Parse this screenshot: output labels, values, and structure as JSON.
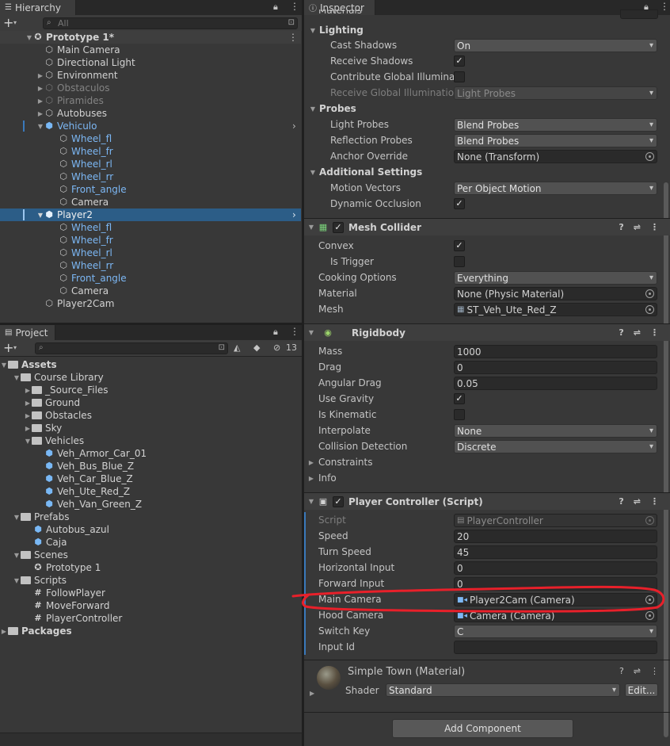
{
  "hierarchy": {
    "tab_label": "Hierarchy",
    "search_placeholder": "All",
    "scene_name": "Prototype 1*",
    "items": [
      {
        "label": "Main Camera"
      },
      {
        "label": "Directional Light"
      },
      {
        "label": "Environment"
      },
      {
        "label": "Obstaculos"
      },
      {
        "label": "Piramides"
      },
      {
        "label": "Autobuses"
      },
      {
        "label": "Vehiculo"
      },
      {
        "label": "Wheel_fl"
      },
      {
        "label": "Wheel_fr"
      },
      {
        "label": "Wheel_rl"
      },
      {
        "label": "Wheel_rr"
      },
      {
        "label": "Front_angle"
      },
      {
        "label": "Camera"
      },
      {
        "label": "Player2"
      },
      {
        "label": "Wheel_fl"
      },
      {
        "label": "Wheel_fr"
      },
      {
        "label": "Wheel_rl"
      },
      {
        "label": "Wheel_rr"
      },
      {
        "label": "Front_angle"
      },
      {
        "label": "Camera"
      },
      {
        "label": "Player2Cam"
      }
    ]
  },
  "project": {
    "tab_label": "Project",
    "hidden_count": "13",
    "tree": [
      {
        "label": "Assets"
      },
      {
        "label": "Course Library"
      },
      {
        "label": "_Source_Files"
      },
      {
        "label": "Ground"
      },
      {
        "label": "Obstacles"
      },
      {
        "label": "Sky"
      },
      {
        "label": "Vehicles"
      },
      {
        "label": "Veh_Armor_Car_01"
      },
      {
        "label": "Veh_Bus_Blue_Z"
      },
      {
        "label": "Veh_Car_Blue_Z"
      },
      {
        "label": "Veh_Ute_Red_Z"
      },
      {
        "label": "Veh_Van_Green_Z"
      },
      {
        "label": "Prefabs"
      },
      {
        "label": "Autobus_azul"
      },
      {
        "label": "Caja"
      },
      {
        "label": "Scenes"
      },
      {
        "label": "Prototype 1"
      },
      {
        "label": "Scripts"
      },
      {
        "label": "FollowPlayer"
      },
      {
        "label": "MoveForward"
      },
      {
        "label": "PlayerController"
      },
      {
        "label": "Packages"
      }
    ]
  },
  "inspector": {
    "tab_label": "Inspector",
    "top_cut_label": "Materials",
    "lighting": {
      "header": "Lighting",
      "cast_shadows_label": "Cast Shadows",
      "cast_shadows_value": "On",
      "receive_shadows_label": "Receive Shadows",
      "contribute_gi_label": "Contribute Global Illumination",
      "receive_gi_label": "Receive Global Illumination",
      "receive_gi_value": "Light Probes"
    },
    "probes": {
      "header": "Probes",
      "light_probes_label": "Light Probes",
      "light_probes_value": "Blend Probes",
      "reflection_probes_label": "Reflection Probes",
      "reflection_probes_value": "Blend Probes",
      "anchor_override_label": "Anchor Override",
      "anchor_override_value": "None (Transform)"
    },
    "additional": {
      "header": "Additional Settings",
      "motion_vectors_label": "Motion Vectors",
      "motion_vectors_value": "Per Object Motion",
      "dynamic_occlusion_label": "Dynamic Occlusion"
    },
    "mesh_collider": {
      "title": "Mesh Collider",
      "convex_label": "Convex",
      "is_trigger_label": "Is Trigger",
      "cooking_label": "Cooking Options",
      "cooking_value": "Everything",
      "material_label": "Material",
      "material_value": "None (Physic Material)",
      "mesh_label": "Mesh",
      "mesh_value": "ST_Veh_Ute_Red_Z"
    },
    "rigidbody": {
      "title": "Rigidbody",
      "mass_label": "Mass",
      "mass_value": "1000",
      "drag_label": "Drag",
      "drag_value": "0",
      "angular_drag_label": "Angular Drag",
      "angular_drag_value": "0.05",
      "use_gravity_label": "Use Gravity",
      "is_kinematic_label": "Is Kinematic",
      "interpolate_label": "Interpolate",
      "interpolate_value": "None",
      "collision_label": "Collision Detection",
      "collision_value": "Discrete",
      "constraints_label": "Constraints",
      "info_label": "Info"
    },
    "player_controller": {
      "title": "Player Controller (Script)",
      "script_label": "Script",
      "script_value": "PlayerController",
      "speed_label": "Speed",
      "speed_value": "20",
      "turn_speed_label": "Turn Speed",
      "turn_speed_value": "45",
      "horizontal_label": "Horizontal Input",
      "horizontal_value": "0",
      "forward_label": "Forward Input",
      "forward_value": "0",
      "main_camera_label": "Main Camera",
      "main_camera_value": "Player2Cam (Camera)",
      "hood_camera_label": "Hood Camera",
      "hood_camera_value": "Camera (Camera)",
      "switch_key_label": "Switch Key",
      "switch_key_value": "C",
      "input_id_label": "Input Id",
      "input_id_value": ""
    },
    "material": {
      "title": "Simple Town (Material)",
      "shader_label": "Shader",
      "shader_value": "Standard",
      "edit_label": "Edit..."
    },
    "add_component_label": "Add Component"
  },
  "colors": {
    "selection": "#2c5d87",
    "accent_bar": "#3a79bb",
    "highlight_stroke": "#e8202a",
    "prefab_blue": "#7cb7f4"
  }
}
